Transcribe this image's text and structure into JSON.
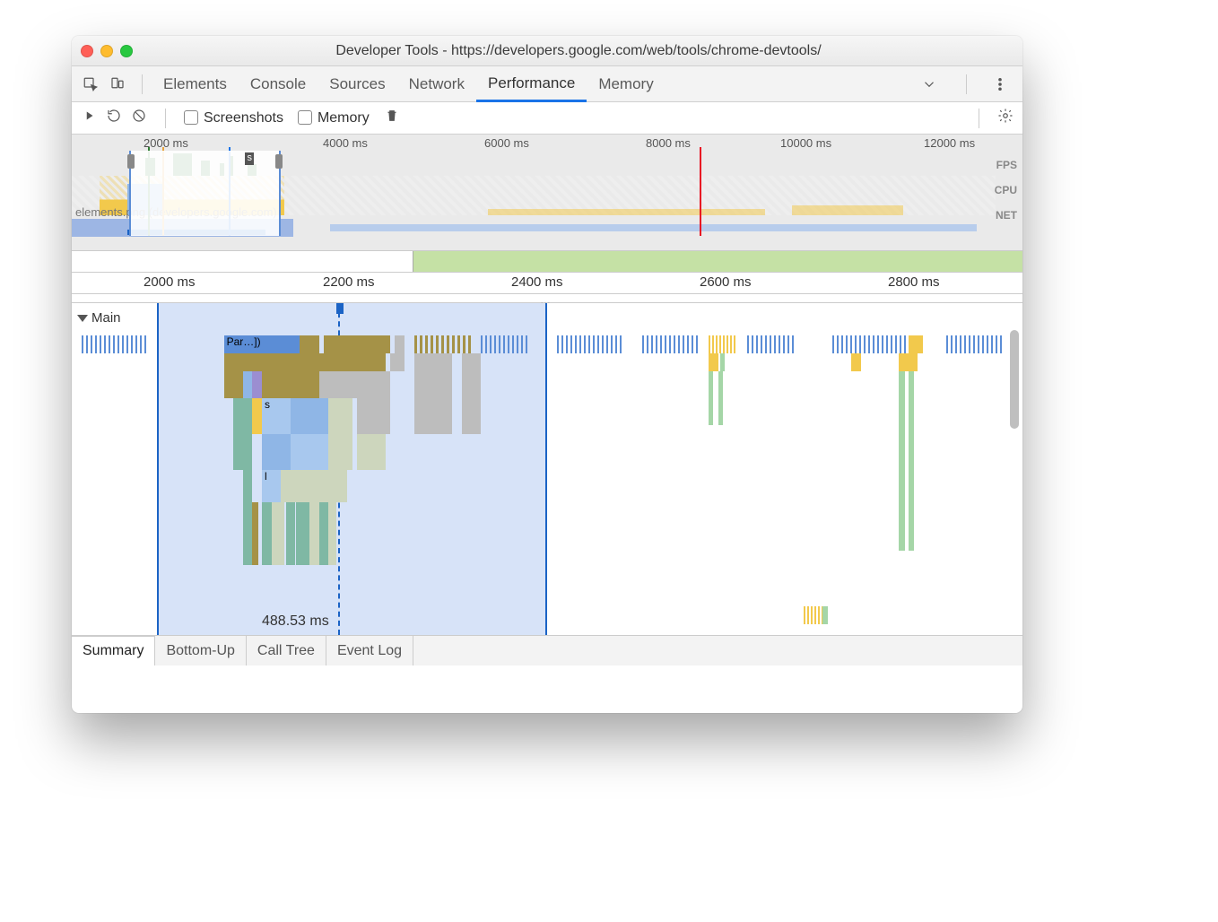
{
  "window": {
    "title": "Developer Tools - https://developers.google.com/web/tools/chrome-devtools/"
  },
  "tabs": {
    "items": [
      "Elements",
      "Console",
      "Sources",
      "Network",
      "Performance",
      "Memory"
    ],
    "active_index": 4
  },
  "toolbar": {
    "screenshots_label": "Screenshots",
    "memory_label": "Memory"
  },
  "overview": {
    "ticks": [
      "2000 ms",
      "4000 ms",
      "6000 ms",
      "8000 ms",
      "10000 ms",
      "12000 ms"
    ],
    "labels": [
      "FPS",
      "CPU",
      "NET"
    ],
    "net_label": "elements.png (developers.google.com)",
    "net_selection_label": "s",
    "selection_start_pct": 6,
    "selection_end_pct": 22,
    "redline_pct": 66,
    "greenline_pct": 8,
    "orangeline_pct": 9.5,
    "blueline_pct": 16.5
  },
  "ruler": {
    "ticks": [
      "2000 ms",
      "2200 ms",
      "2400 ms",
      "2600 ms",
      "2800 ms"
    ]
  },
  "ellipsis": "…",
  "flame": {
    "main_label": "Main",
    "selection_start_pct": 9,
    "selection_end_pct": 50,
    "playhead_pct": 28,
    "duration_label": "488.53 ms",
    "cells_r1": {
      "parse_label": "Par…])",
      "s_label": "s",
      "l_label": "l"
    }
  },
  "bottom_tabs": {
    "items": [
      "Summary",
      "Bottom-Up",
      "Call Tree",
      "Event Log"
    ],
    "active_index": 0
  },
  "colors": {
    "script": "#f2c94c",
    "script_dark": "#a59247",
    "layout": "#8fb6e6",
    "paint": "#a5d6a7",
    "gray": "#bdbdbd",
    "blue_task": "#5b8dd6",
    "teal": "#7fb8a4"
  }
}
